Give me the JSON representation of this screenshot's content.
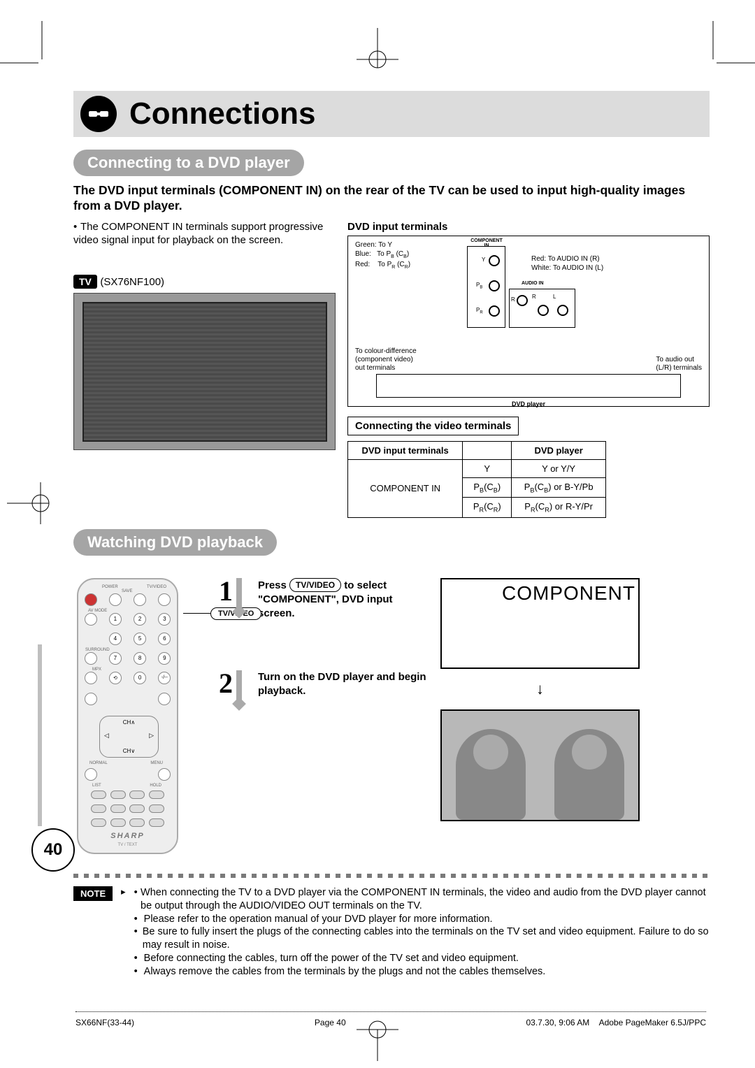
{
  "title": "Connections",
  "section1": {
    "heading": "Connecting to a DVD player",
    "intro": "The DVD input terminals (COMPONENT IN) on the rear of the TV can be used to input high-quality images from a DVD player.",
    "bullet1": "The COMPONENT IN terminals support progressive video signal input for playback on the screen.",
    "tv_badge": "TV",
    "tv_model": "(SX76NF100)"
  },
  "dvd_diagram": {
    "title": "DVD input terminals",
    "green": "Green: To Y",
    "blue_a": "Blue:",
    "blue_b": "To P",
    "blue_c": " (C",
    "red_a": "Red:",
    "red_b": "To P",
    "red_c": " (C",
    "compin": "COMPONENT IN",
    "audioin": "AUDIO IN",
    "y": "Y",
    "pb": "P",
    "pr": "P",
    "r": "R",
    "l": "L",
    "red_audio": "Red:   To AUDIO IN (R)",
    "white_audio": "White: To AUDIO IN (L)",
    "colour_diff1": "To colour-difference",
    "colour_diff2": "(component video)",
    "colour_diff3": "out terminals",
    "audio_out1": "To audio out",
    "audio_out2": "(L/R) terminals",
    "dvdplayer": "DVD player"
  },
  "conn_table": {
    "subtitle": "Connecting the video terminals",
    "h1": "DVD input terminals",
    "h2": "DVD player",
    "r1c1": "COMPONENT IN",
    "r1c2": "Y",
    "r1c3": "Y or Y/Y",
    "r2c2_a": "P",
    "r2c2_b": "(C",
    "r2c2_c": ")",
    "r2c3_a": "P",
    "r2c3_b": "(C",
    "r2c3_c": ") or B-Y/Pb",
    "r3c2_a": "P",
    "r3c2_b": "(C",
    "r3c2_c": ")",
    "r3c3_a": "P",
    "r3c3_b": "(C",
    "r3c3_c": ") or R-Y/Pr"
  },
  "section2": {
    "heading": "Watching DVD playback",
    "tv_video_callout": "TV/VIDEO",
    "step1_a": "Press ",
    "step1_btn": "TV/VIDEO",
    "step1_b": " to select \"COMPONENT\", DVD input screen.",
    "step2": "Turn on the DVD player and begin playback.",
    "osd": "COMPONENT"
  },
  "remote": {
    "power": "POWER",
    "save": "SAVE",
    "tvvideo": "TV/VIDEO",
    "avmode": "AV MODE",
    "surround": "SURROUND",
    "mpx": "MPX",
    "normal": "NORMAL",
    "menu": "MENU",
    "list": "LIST",
    "hold": "HOLD",
    "ch_up": "CH",
    "ch_dn": "CH",
    "brand": "SHARP",
    "subbrand": "TV / TEXT"
  },
  "note": {
    "label": "NOTE",
    "items": [
      "When connecting the TV to a DVD player via the COMPONENT IN terminals, the video and audio from the DVD player cannot be output through the AUDIO/VIDEO OUT terminals on the TV.",
      "Please refer to the operation manual of your DVD player for more information.",
      "Be sure to fully insert the plugs of the connecting cables into the terminals on the TV set and video equipment. Failure to do so may result in noise.",
      "Before connecting the cables, turn off the power of the TV set and video equipment.",
      "Always remove the cables from the terminals by the plugs and not the cables themselves."
    ]
  },
  "page_number": "40",
  "footer": {
    "doc": "SX66NF(33-44)",
    "page": "Page 40",
    "date": "03.7.30, 9:06 AM",
    "app": "Adobe PageMaker 6.5J/PPC"
  }
}
